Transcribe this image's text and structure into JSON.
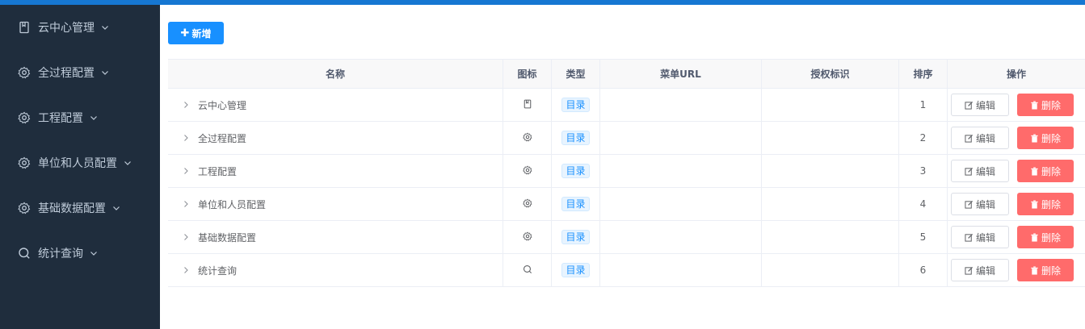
{
  "sidebar": {
    "items": [
      {
        "label": "云中心管理",
        "icon": "book-icon"
      },
      {
        "label": "全过程配置",
        "icon": "gear-icon"
      },
      {
        "label": "工程配置",
        "icon": "gear-icon"
      },
      {
        "label": "单位和人员配置",
        "icon": "gear-icon"
      },
      {
        "label": "基础数据配置",
        "icon": "gear-icon"
      },
      {
        "label": "统计查询",
        "icon": "search-icon"
      }
    ]
  },
  "toolbar": {
    "add_label": "新增",
    "add_icon": "plus-icon"
  },
  "table": {
    "headers": {
      "name": "名称",
      "icon": "图标",
      "type": "类型",
      "url": "菜单URL",
      "perm": "授权标识",
      "sort": "排序",
      "op": "操作"
    },
    "edit_label": "编辑",
    "delete_label": "删除",
    "rows": [
      {
        "name": "云中心管理",
        "icon": "book-icon",
        "type": "目录",
        "url": "",
        "perm": "",
        "sort": "1"
      },
      {
        "name": "全过程配置",
        "icon": "gear-icon",
        "type": "目录",
        "url": "",
        "perm": "",
        "sort": "2"
      },
      {
        "name": "工程配置",
        "icon": "gear-icon",
        "type": "目录",
        "url": "",
        "perm": "",
        "sort": "3"
      },
      {
        "name": "单位和人员配置",
        "icon": "gear-icon",
        "type": "目录",
        "url": "",
        "perm": "",
        "sort": "4"
      },
      {
        "name": "基础数据配置",
        "icon": "gear-icon",
        "type": "目录",
        "url": "",
        "perm": "",
        "sort": "5"
      },
      {
        "name": "统计查询",
        "icon": "search-icon",
        "type": "目录",
        "url": "",
        "perm": "",
        "sort": "6"
      }
    ]
  },
  "colors": {
    "topbar": "#1677d2",
    "sidebar": "#1f2d3d",
    "primary": "#1890ff",
    "danger": "#ff6b6b"
  }
}
